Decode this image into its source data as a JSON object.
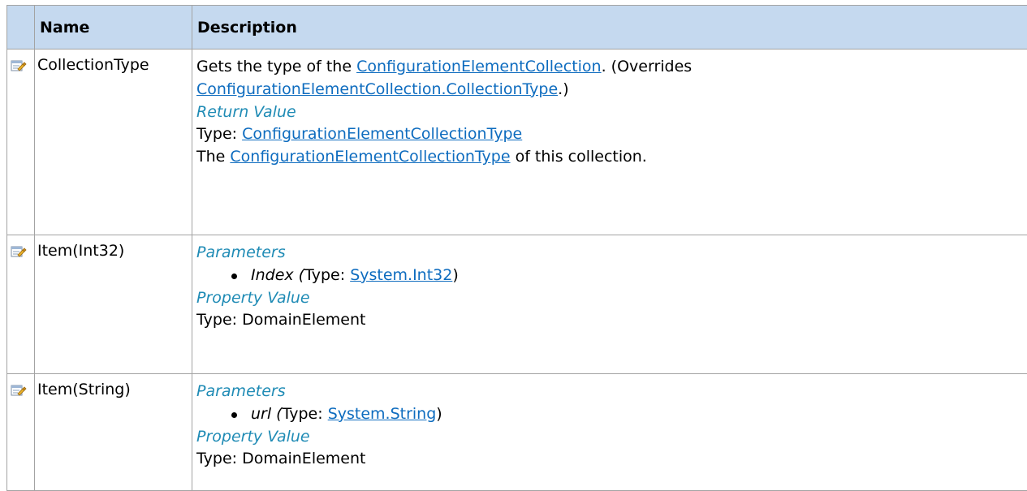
{
  "header": {
    "name_label": "Name",
    "description_label": "Description"
  },
  "rows": [
    {
      "icon": "property-icon",
      "name": "CollectionType",
      "summary_before": "Gets the type of the ",
      "summary_link": "ConfigurationElementCollection",
      "summary_middle": ". (Overrides ",
      "overrides_link": "ConfigurationElementCollection.CollectionType",
      "summary_after": ".)",
      "return_heading": "Return Value",
      "type_prefix": "Type: ",
      "type_link": "ConfigurationElementCollectionType",
      "remark_before": "The ",
      "remark_link": "ConfigurationElementCollectionType",
      "remark_after": " of this collection."
    },
    {
      "icon": "property-icon",
      "name": "Item(Int32)",
      "params_heading": "Parameters",
      "param_name": "Index",
      "param_open": " (",
      "param_type_prefix": "Type: ",
      "param_type_link": "System.Int32",
      "param_close": ")",
      "value_heading": "Property Value",
      "value_type": "Type: DomainElement"
    },
    {
      "icon": "property-icon",
      "name": "Item(String)",
      "params_heading": "Parameters",
      "param_name": "url",
      "param_open": " (",
      "param_type_prefix": "Type: ",
      "param_type_link": "System.String",
      "param_close": ")",
      "value_heading": "Property Value",
      "value_type": "Type: DomainElement"
    }
  ]
}
